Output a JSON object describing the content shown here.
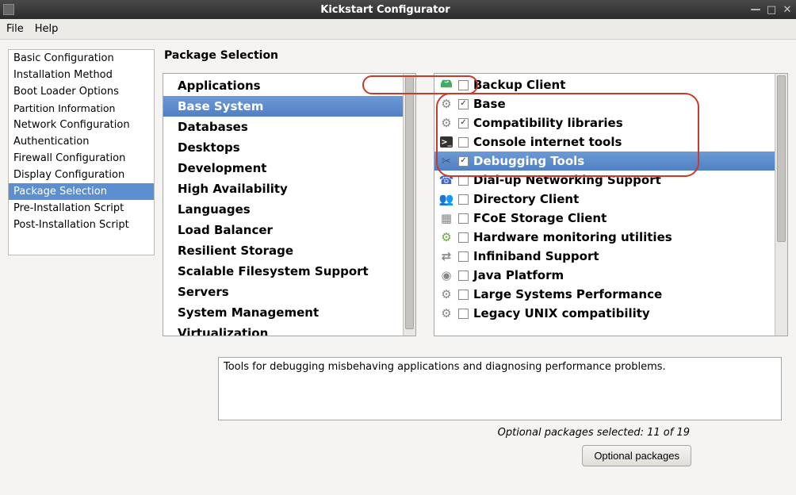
{
  "window": {
    "title": "Kickstart Configurator"
  },
  "menubar": {
    "items": [
      "File",
      "Help"
    ]
  },
  "sidebar": {
    "items": [
      "Basic Configuration",
      "Installation Method",
      "Boot Loader Options",
      "Partition Information",
      "Network Configuration",
      "Authentication",
      "Firewall Configuration",
      "Display Configuration",
      "Package Selection",
      "Pre-Installation Script",
      "Post-Installation Script"
    ],
    "selected_index": 8
  },
  "page": {
    "title": "Package Selection"
  },
  "categories": {
    "items": [
      "Applications",
      "Base System",
      "Databases",
      "Desktops",
      "Development",
      "High Availability",
      "Languages",
      "Load Balancer",
      "Resilient Storage",
      "Scalable Filesystem Support",
      "Servers",
      "System Management",
      "Virtualization"
    ],
    "selected_index": 1
  },
  "packages": {
    "items": [
      {
        "icon": "drive",
        "checked": false,
        "label": "Backup Client"
      },
      {
        "icon": "gear",
        "checked": true,
        "label": "Base"
      },
      {
        "icon": "gear",
        "checked": true,
        "label": "Compatibility libraries"
      },
      {
        "icon": "term",
        "checked": false,
        "label": "Console internet tools"
      },
      {
        "icon": "tools",
        "checked": true,
        "label": "Debugging Tools"
      },
      {
        "icon": "phone",
        "checked": false,
        "label": "Dial-up Networking Support"
      },
      {
        "icon": "users",
        "checked": false,
        "label": "Directory Client"
      },
      {
        "icon": "box",
        "checked": false,
        "label": "FCoE Storage Client"
      },
      {
        "icon": "hw",
        "checked": false,
        "label": "Hardware monitoring utilities"
      },
      {
        "icon": "net",
        "checked": false,
        "label": "Infiniband Support"
      },
      {
        "icon": "disc",
        "checked": false,
        "label": "Java Platform"
      },
      {
        "icon": "gear",
        "checked": false,
        "label": "Large Systems Performance"
      },
      {
        "icon": "gear",
        "checked": false,
        "label": "Legacy UNIX compatibility"
      }
    ],
    "selected_index": 4
  },
  "description": "Tools for debugging misbehaving applications and diagnosing performance problems.",
  "footer": {
    "status": "Optional packages selected: 11 of 19",
    "button": "Optional packages"
  }
}
